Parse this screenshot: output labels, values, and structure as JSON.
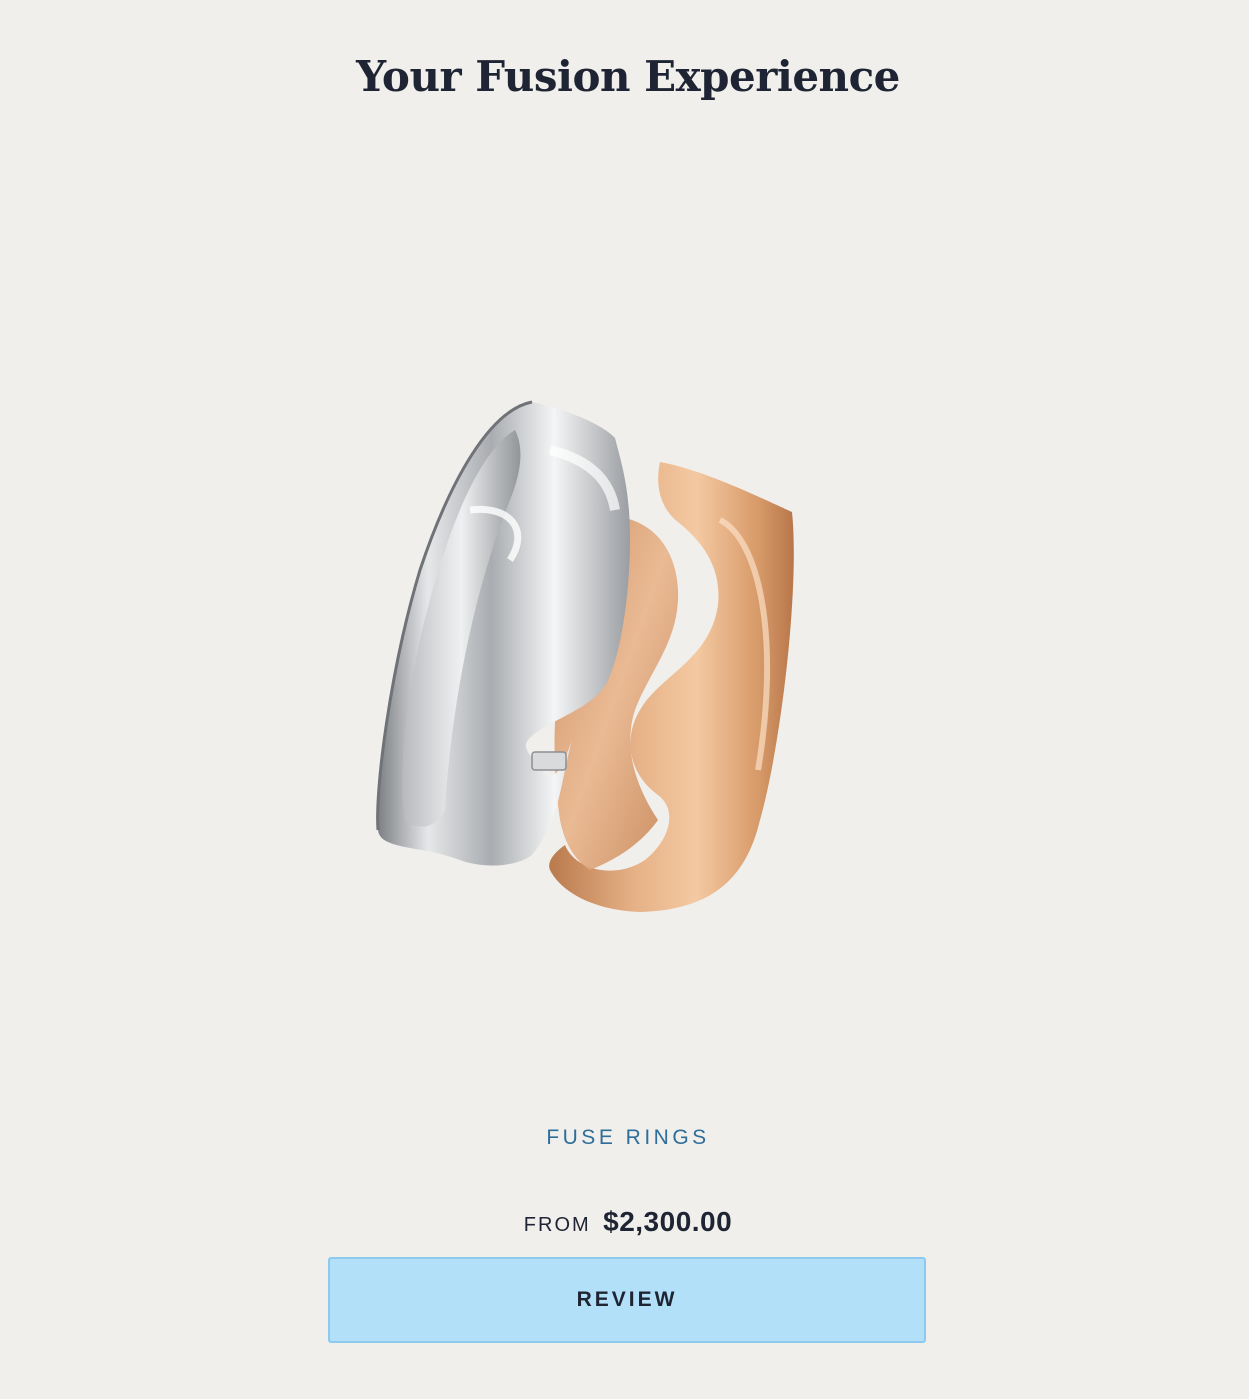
{
  "page": {
    "title": "Your Fusion Experience"
  },
  "product": {
    "image_icon": "fuse-rings-image",
    "name": "FUSE RINGS",
    "price_prefix": "FROM",
    "price": "$2,300.00"
  },
  "actions": {
    "review_label": "REVIEW"
  },
  "colors": {
    "background": "#f0efec",
    "title_text": "#1e2433",
    "product_name": "#2f6e99",
    "button_bg": "#b3e0f9",
    "button_border": "#8ccaf0",
    "silver": "#c8cacc",
    "rose_gold": "#dca274"
  }
}
